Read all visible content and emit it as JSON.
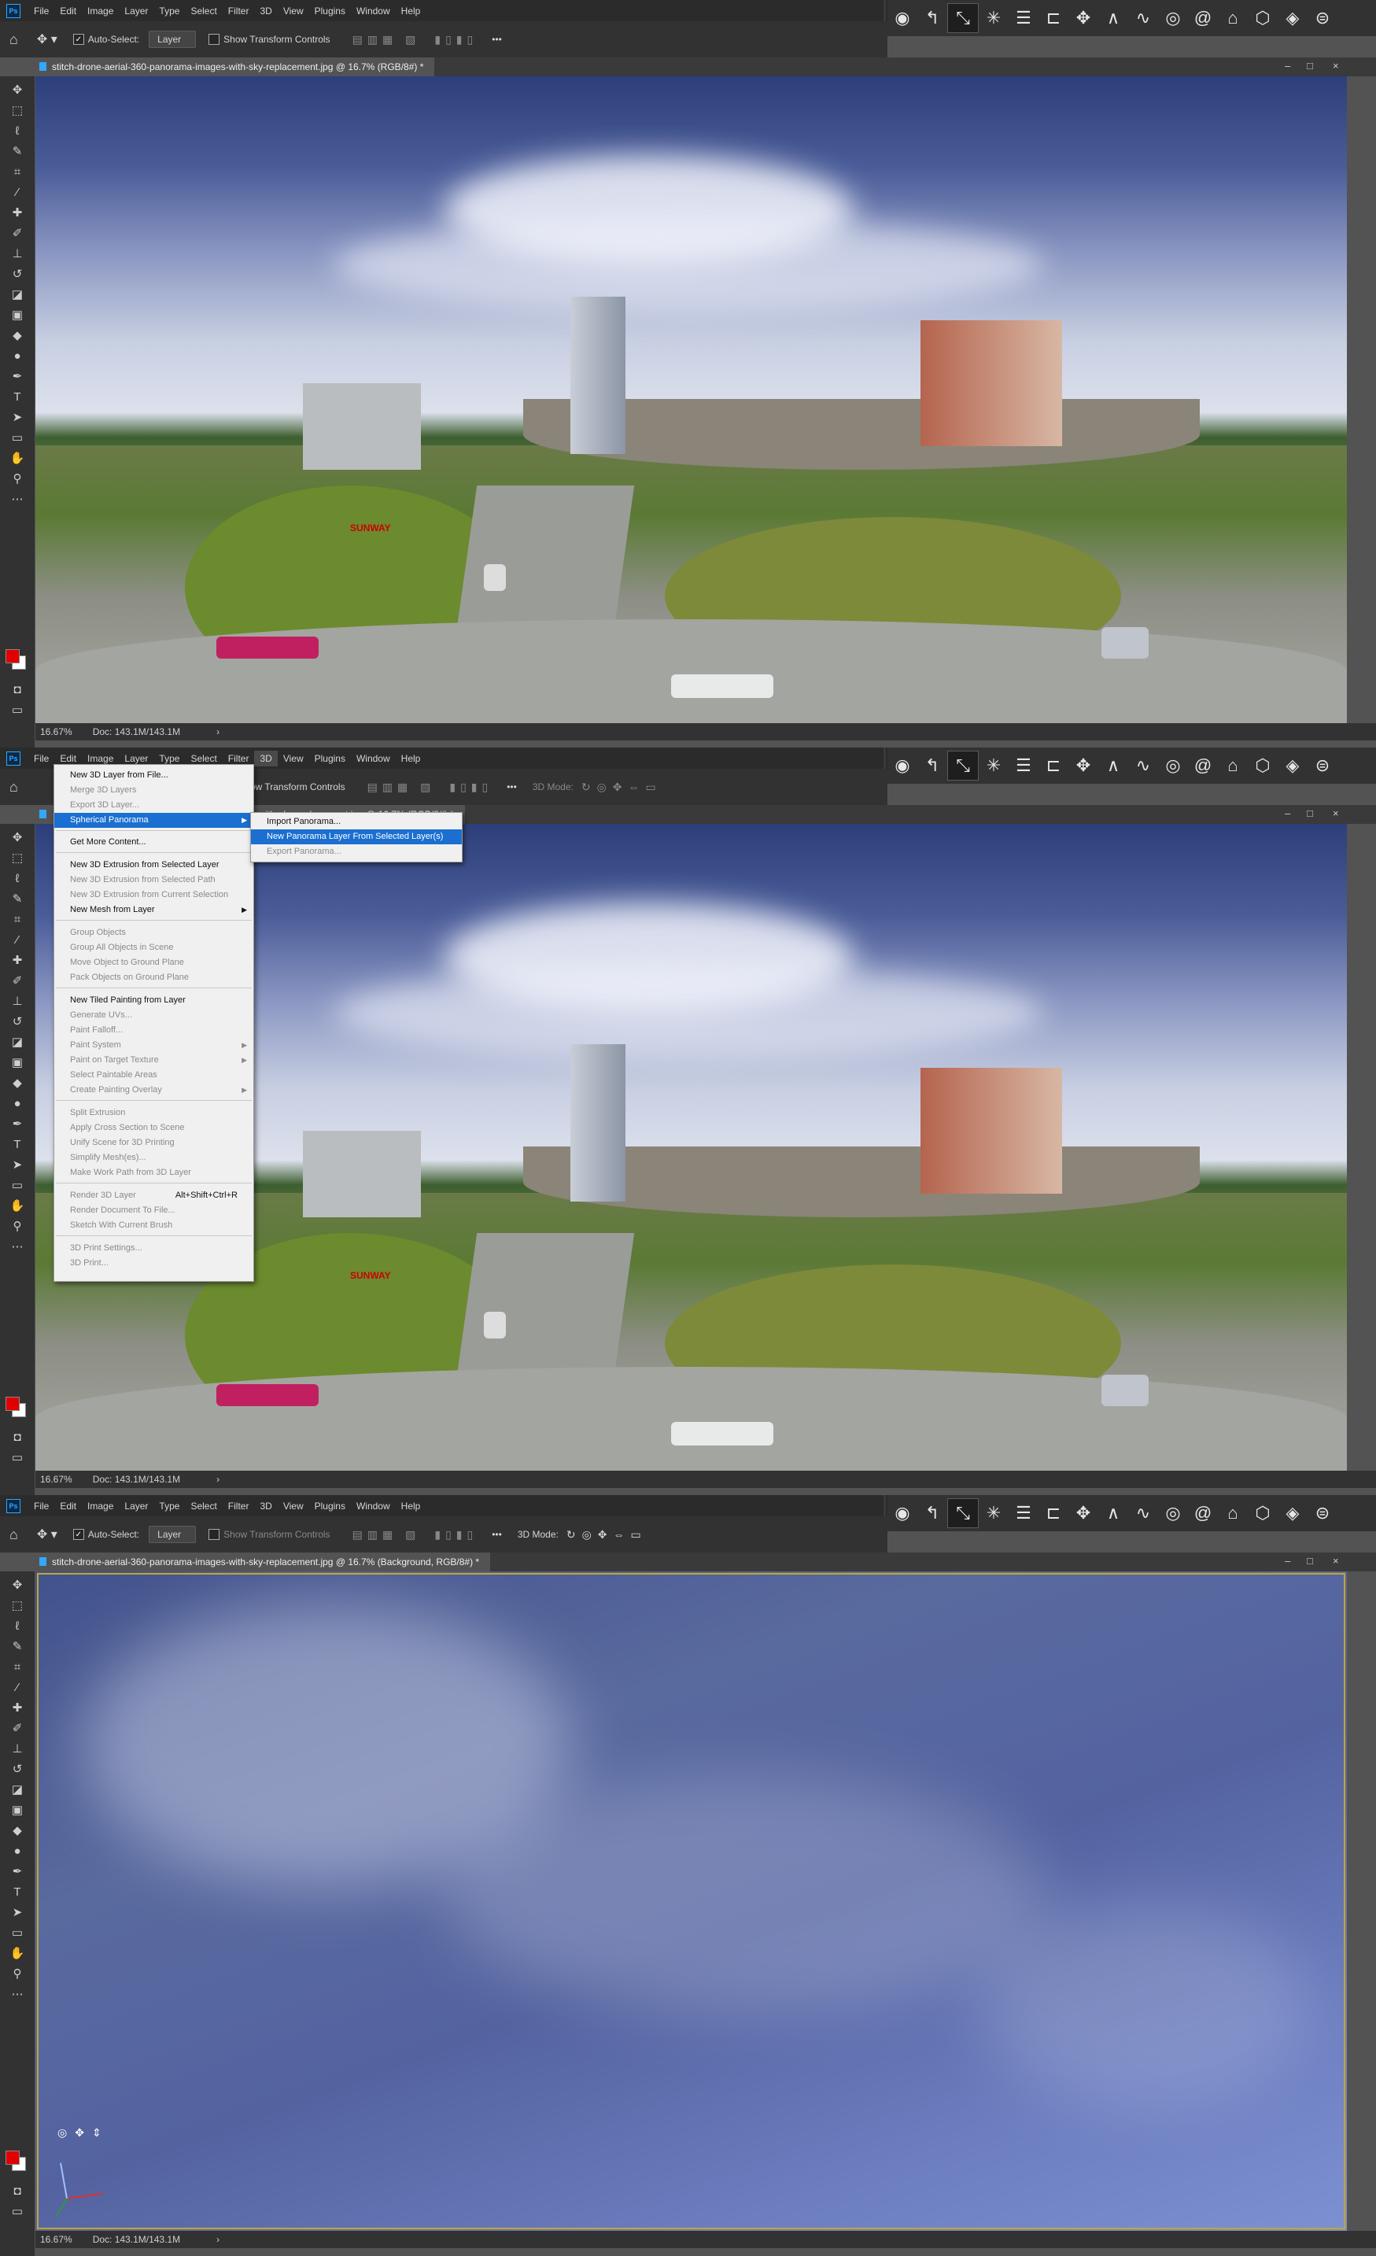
{
  "menu": [
    "File",
    "Edit",
    "Image",
    "Layer",
    "Type",
    "Select",
    "Filter",
    "3D",
    "View",
    "Plugins",
    "Window",
    "Help"
  ],
  "options": {
    "auto_select_label": "Auto-Select:",
    "auto_select_value": "Layer",
    "show_transform_label": "Show Transform Controls",
    "show_transform_label_cut": "ow Transform Controls",
    "mode_3d_label": "3D Mode:",
    "more": "•••"
  },
  "window_controls": {
    "minimize": "–",
    "restore": "□",
    "close": "×"
  },
  "shot1": {
    "doc_tab": "stitch-drone-aerial-360-panorama-images-with-sky-replacement.jpg @ 16.7% (RGB/8#) *",
    "zoom": "16.67%",
    "doc_size": "Doc: 143.1M/143.1M",
    "nav_arrow": "›"
  },
  "shot2": {
    "doc_tab_fragment": "with-sky-replacement.jpg @ 16.7% (RGB/8#) *",
    "zoom": "16.67%",
    "doc_size": "Doc: 143.1M/143.1M",
    "nav_arrow": "›",
    "menu_3d": {
      "items": [
        {
          "label": "New 3D Layer from File...",
          "state": "enabled"
        },
        {
          "label": "Merge 3D Layers",
          "state": "disabled"
        },
        {
          "label": "Export 3D Layer...",
          "state": "disabled"
        },
        {
          "label": "Spherical Panorama",
          "state": "highlighted",
          "submenu": true
        },
        {
          "label": "Get More Content...",
          "state": "enabled"
        },
        {
          "label": "New 3D Extrusion from Selected Layer",
          "state": "enabled"
        },
        {
          "label": "New 3D Extrusion from Selected Path",
          "state": "disabled"
        },
        {
          "label": "New 3D Extrusion from Current Selection",
          "state": "disabled"
        },
        {
          "label": "New Mesh from Layer",
          "state": "enabled",
          "submenu": true
        },
        {
          "label": "Group Objects",
          "state": "disabled"
        },
        {
          "label": "Group All Objects in Scene",
          "state": "disabled"
        },
        {
          "label": "Move Object to Ground Plane",
          "state": "disabled"
        },
        {
          "label": "Pack Objects on Ground Plane",
          "state": "disabled"
        },
        {
          "label": "New Tiled Painting from Layer",
          "state": "enabled"
        },
        {
          "label": "Generate UVs...",
          "state": "disabled"
        },
        {
          "label": "Paint Falloff...",
          "state": "disabled"
        },
        {
          "label": "Paint System",
          "state": "disabled",
          "submenu": true
        },
        {
          "label": "Paint on Target Texture",
          "state": "disabled",
          "submenu": true
        },
        {
          "label": "Select Paintable Areas",
          "state": "disabled"
        },
        {
          "label": "Create Painting Overlay",
          "state": "disabled",
          "submenu": true
        },
        {
          "label": "Split Extrusion",
          "state": "disabled"
        },
        {
          "label": "Apply Cross Section to Scene",
          "state": "disabled"
        },
        {
          "label": "Unify Scene for 3D Printing",
          "state": "disabled"
        },
        {
          "label": "Simplify Mesh(es)...",
          "state": "disabled"
        },
        {
          "label": "Make Work Path from 3D Layer",
          "state": "disabled"
        },
        {
          "label": "Render 3D Layer",
          "state": "disabled",
          "shortcut": "Alt+Shift+Ctrl+R"
        },
        {
          "label": "Render Document To File...",
          "state": "disabled"
        },
        {
          "label": "Sketch With Current Brush",
          "state": "disabled"
        },
        {
          "label": "3D Print Settings...",
          "state": "disabled"
        },
        {
          "label": "3D Print...",
          "state": "disabled"
        }
      ]
    },
    "submenu_spherical": {
      "items": [
        {
          "label": "Import Panorama...",
          "state": "enabled"
        },
        {
          "label": "New Panorama Layer From Selected Layer(s)",
          "state": "highlighted"
        },
        {
          "label": "Export Panorama...",
          "state": "disabled"
        }
      ]
    }
  },
  "shot3": {
    "doc_tab": "stitch-drone-aerial-360-panorama-images-with-sky-replacement.jpg @ 16.7% (Background, RGB/8#) *",
    "zoom": "16.67%",
    "doc_size": "Doc: 143.1M/143.1M",
    "nav_arrow": "›"
  },
  "panorama_sign": "SUNWAY",
  "icons": {
    "toolbar_3d": [
      "orbit-icon",
      "roll-icon",
      "drag-icon",
      "light-icon",
      "align-icon",
      "distribute-icon",
      "snap-icon",
      "camera-icon",
      "slide-icon",
      "ring-icon",
      "spiral-icon",
      "cone-icon",
      "cube-icon",
      "cylinder-icon",
      "sphere-icon"
    ],
    "tools": [
      "move-icon",
      "marquee-icon",
      "lasso-icon",
      "quick-select-icon",
      "crop-icon",
      "eyedropper-icon",
      "healing-icon",
      "brush-icon",
      "stamp-icon",
      "history-brush-icon",
      "eraser-icon",
      "gradient-icon",
      "blur-icon",
      "dodge-icon",
      "pen-icon",
      "type-icon",
      "path-select-icon",
      "shape-icon",
      "hand-icon",
      "zoom-icon"
    ]
  },
  "colors": {
    "foreground_swatch": "#e00000",
    "background_swatch": "#ffffff",
    "menu_highlight": "#1a6fd0",
    "frame_border": "#c6a52a"
  }
}
